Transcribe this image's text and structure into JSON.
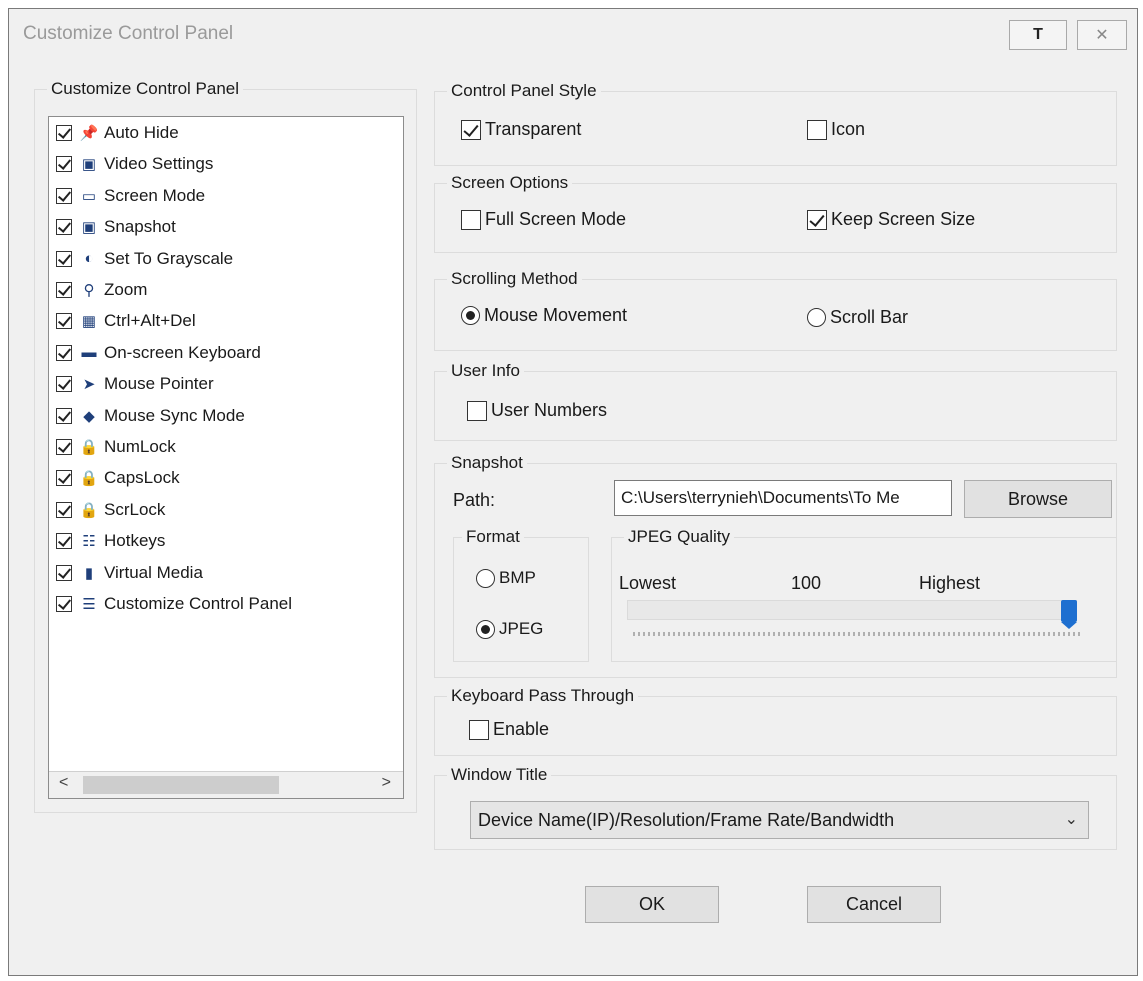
{
  "window": {
    "title": "Customize Control Panel",
    "pin_label": "T",
    "close_label": "✕"
  },
  "customize_group": {
    "label": "Customize Control Panel",
    "items": [
      {
        "label": "Auto Hide",
        "checked": true,
        "icon": "pin-icon"
      },
      {
        "label": "Video Settings",
        "checked": true,
        "icon": "video-settings-icon"
      },
      {
        "label": "Screen Mode",
        "checked": true,
        "icon": "monitor-icon"
      },
      {
        "label": "Snapshot",
        "checked": true,
        "icon": "camera-icon"
      },
      {
        "label": "Set To Grayscale",
        "checked": true,
        "icon": "contrast-icon"
      },
      {
        "label": "Zoom",
        "checked": true,
        "icon": "magnifier-icon"
      },
      {
        "label": "Ctrl+Alt+Del",
        "checked": true,
        "icon": "keys-icon"
      },
      {
        "label": "On-screen Keyboard",
        "checked": true,
        "icon": "keyboard-icon"
      },
      {
        "label": "Mouse Pointer",
        "checked": true,
        "icon": "cursor-icon"
      },
      {
        "label": "Mouse Sync Mode",
        "checked": true,
        "icon": "mouse-icon"
      },
      {
        "label": "NumLock",
        "checked": true,
        "icon": "lock-icon"
      },
      {
        "label": "CapsLock",
        "checked": true,
        "icon": "lock-icon"
      },
      {
        "label": "ScrLock",
        "checked": true,
        "icon": "lock-icon"
      },
      {
        "label": "Hotkeys",
        "checked": true,
        "icon": "hotkeys-icon"
      },
      {
        "label": "Virtual Media",
        "checked": true,
        "icon": "usb-icon"
      },
      {
        "label": "Customize Control Panel",
        "checked": true,
        "icon": "sliders-icon"
      }
    ],
    "scroll_left": "<",
    "scroll_right": ">"
  },
  "style_group": {
    "label": "Control Panel Style",
    "transparent_label": "Transparent",
    "transparent_checked": true,
    "icon_label": "Icon",
    "icon_checked": false
  },
  "screen_group": {
    "label": "Screen Options",
    "fullscreen_label": "Full Screen Mode",
    "fullscreen_checked": false,
    "keepsize_label": "Keep Screen Size",
    "keepsize_checked": true
  },
  "scrolling_group": {
    "label": "Scrolling Method",
    "mouse_label": "Mouse Movement",
    "mouse_selected": true,
    "scrollbar_label": "Scroll Bar",
    "scrollbar_selected": false
  },
  "userinfo_group": {
    "label": "User Info",
    "numbers_label": "User Numbers",
    "numbers_checked": false
  },
  "snapshot_group": {
    "label": "Snapshot",
    "path_label": "Path:",
    "path_value": "C:\\Users\\terrynieh\\Documents\\To Me",
    "browse_label": "Browse",
    "format_label": "Format",
    "bmp_label": "BMP",
    "bmp_selected": false,
    "jpeg_label": "JPEG",
    "jpeg_selected": true,
    "quality_label": "JPEG Quality",
    "lowest_label": "Lowest",
    "quality_value": "100",
    "highest_label": "Highest",
    "quality_fraction": 1.0
  },
  "keyboard_group": {
    "label": "Keyboard Pass Through",
    "enable_label": "Enable",
    "enable_checked": false
  },
  "window_title_group": {
    "label": "Window Title",
    "selected": "Device Name(IP)/Resolution/Frame Rate/Bandwidth"
  },
  "buttons": {
    "ok_label": "OK",
    "cancel_label": "Cancel"
  },
  "colors": {
    "dialog_bg": "#f0f0f0",
    "slider_thumb": "#1e6fd0",
    "icon": "#1f3f7a"
  }
}
